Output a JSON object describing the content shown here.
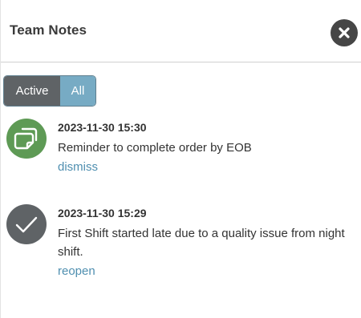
{
  "panel": {
    "title": "Team Notes",
    "close_icon": "close-icon"
  },
  "filter": {
    "options": [
      "Active",
      "All"
    ],
    "selected": "All"
  },
  "notes": [
    {
      "icon": "sticky-note-icon",
      "icon_color": "#5e9a55",
      "timestamp": "2023-11-30 15:30",
      "text": "Reminder to complete order by EOB",
      "action": "dismiss"
    },
    {
      "icon": "checkmark-icon",
      "icon_color": "#5f6366",
      "timestamp": "2023-11-30 15:29",
      "text": "First Shift started late due to a quality issue from night shift.",
      "action": "reopen"
    }
  ],
  "colors": {
    "link": "#4f8fb0",
    "toggle_selected": "#77abc4",
    "toggle_unselected": "#5f6366"
  }
}
